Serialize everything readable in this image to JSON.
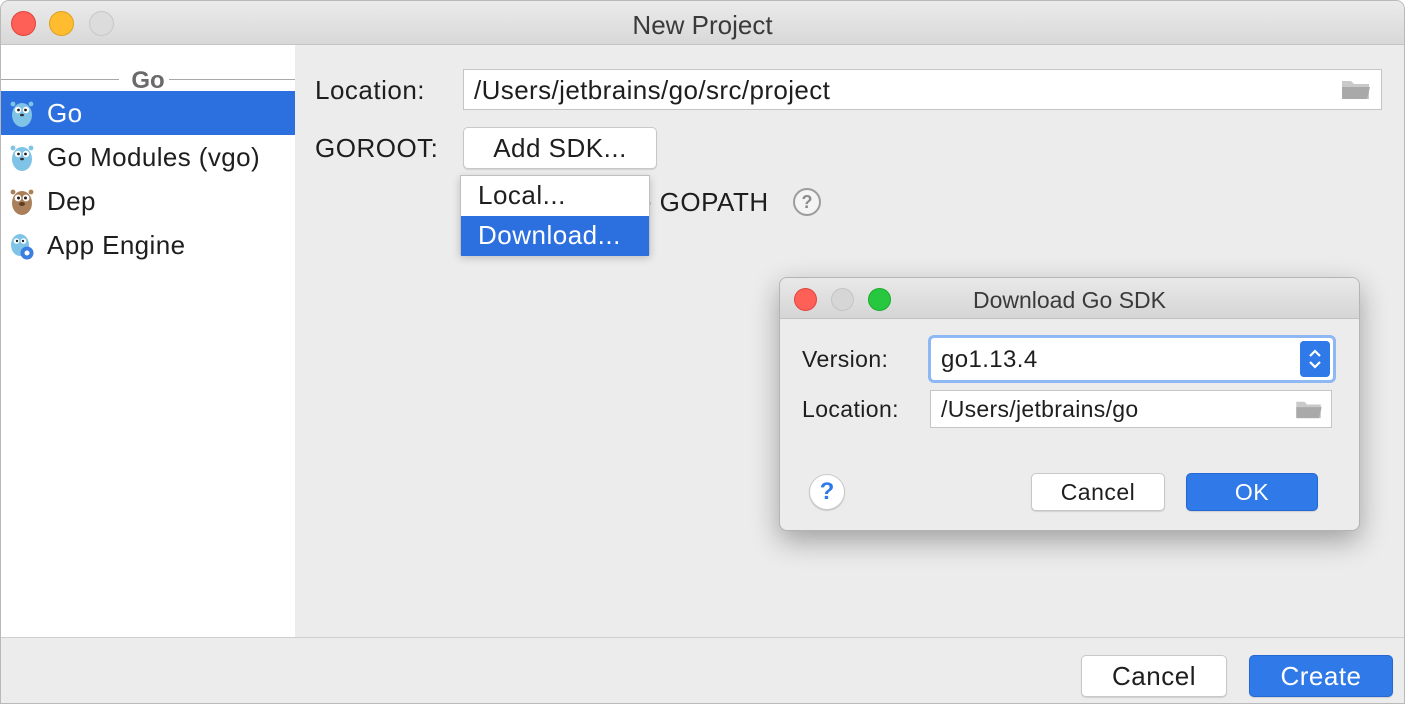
{
  "window": {
    "title": "New Project"
  },
  "sidebar": {
    "group_title": "Go",
    "items": [
      {
        "label": "Go",
        "icon": "gopher-icon",
        "selected": true
      },
      {
        "label": "Go Modules (vgo)",
        "icon": "gopher-icon",
        "selected": false
      },
      {
        "label": "Dep",
        "icon": "dep-gopher-icon",
        "selected": false
      },
      {
        "label": "App Engine",
        "icon": "app-engine-icon",
        "selected": false
      }
    ]
  },
  "main": {
    "location_label": "Location:",
    "location_value": "/Users/jetbrains/go/src/project",
    "goroot_label": "GOROOT:",
    "add_sdk_label": "Add SDK...",
    "gopath_partial_label": "e GOPATH",
    "help_glyph": "?"
  },
  "dropdown": {
    "items": [
      {
        "label": "Local...",
        "selected": false
      },
      {
        "label": "Download...",
        "selected": true
      }
    ]
  },
  "dialog": {
    "title": "Download Go SDK",
    "version_label": "Version:",
    "version_value": "go1.13.4",
    "location_label": "Location:",
    "location_value": "/Users/jetbrains/go",
    "help_glyph": "?",
    "cancel_label": "Cancel",
    "ok_label": "OK"
  },
  "footer": {
    "cancel_label": "Cancel",
    "create_label": "Create"
  },
  "colors": {
    "selection": "#2c6fdf",
    "primary_button": "#2f79e8",
    "traffic_close": "#fe5f57",
    "traffic_minimize": "#febc2e",
    "traffic_zoom": "#27c840"
  }
}
